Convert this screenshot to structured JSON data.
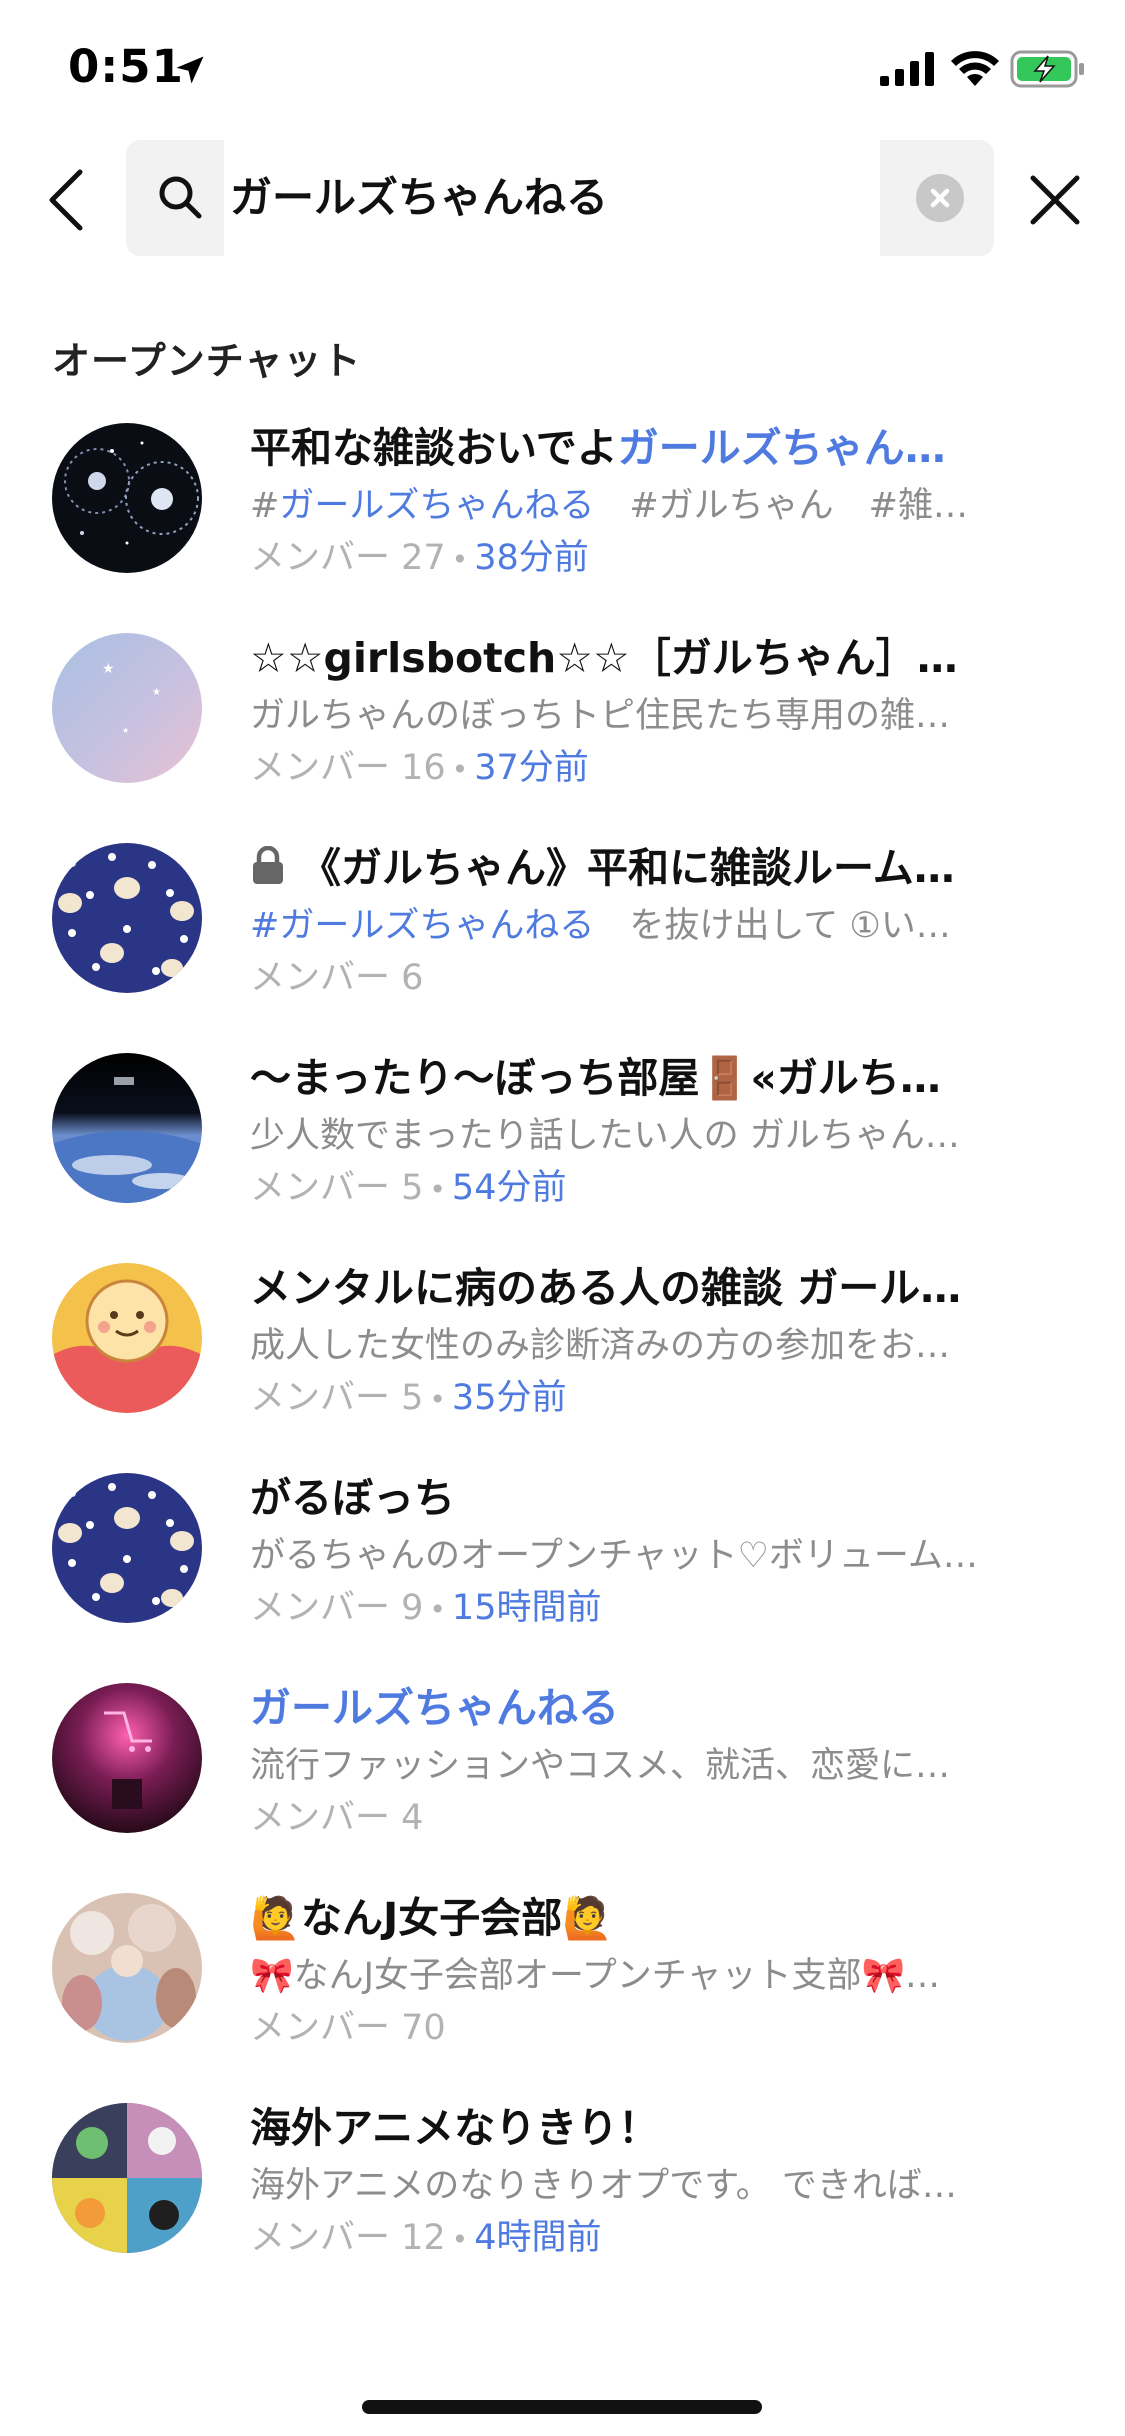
{
  "status_bar": {
    "time": "0:51"
  },
  "search": {
    "query": "ガールズちゃんねる",
    "placeholder": ""
  },
  "section": {
    "title": "オープンチャット"
  },
  "results": [
    {
      "title_plain": "平和な雑談おいでよ",
      "title_highlight": "ガールズちゃん…",
      "desc_prefix": "#",
      "desc_highlight": "ガールズちゃんねる",
      "desc_rest": "　#ガルちゃん　#雑…",
      "members": "メンバー 27",
      "time": "38分前",
      "avatar": "night-sky"
    },
    {
      "title_plain": "☆☆girlsbotch☆☆［ガルちゃん］…",
      "desc_rest": "ガルちゃんのぼっちトピ住民たち専用の雑…",
      "members": "メンバー 16",
      "time": "37分前",
      "avatar": "pastel-sky"
    },
    {
      "locked": true,
      "title_plain": "《ガルちゃん》平和に雑談ルーム…",
      "desc_prefix": "#",
      "desc_highlight": "ガールズちゃんねる",
      "desc_rest": "　を抜け出して ①い…",
      "members": "メンバー 6",
      "time": "",
      "avatar": "bunny-pattern"
    },
    {
      "title_plain": "〜まったり〜ぼっち部屋🚪«ガルち…",
      "desc_rest": "少人数でまったり話したい人の ガルちゃん…",
      "members": "メンバー 5",
      "time": "54分前",
      "avatar": "earth"
    },
    {
      "title_plain": "メンタルに病のある人の雑談 ガール…",
      "desc_rest": "成人した女性のみ診断済みの方の参加をお…",
      "members": "メンバー 5",
      "time": "35分前",
      "avatar": "smiley-heart"
    },
    {
      "title_plain": "がるぼっち",
      "desc_rest": "がるちゃんのオープンチャット♡ボリューム…",
      "members": "メンバー 9",
      "time": "15時間前",
      "avatar": "bunny-pattern"
    },
    {
      "title_highlight": "ガールズちゃんねる",
      "desc_rest": "流行ファッションやコスメ、就活、恋愛に…",
      "members": "メンバー 4",
      "time": "",
      "avatar": "neon-pink"
    },
    {
      "title_plain": "🙋なんJ女子会部🙋",
      "desc_rest": "🎀なんJ女子会部オープンチャット支部🎀…",
      "members": "メンバー 70",
      "time": "",
      "avatar": "painting"
    },
    {
      "title_plain": "海外アニメなりきり！",
      "desc_rest": "海外アニメのなりきりオプです。 できれば…",
      "members": "メンバー 12",
      "time": "4時間前",
      "avatar": "cartoon-collage"
    }
  ]
}
